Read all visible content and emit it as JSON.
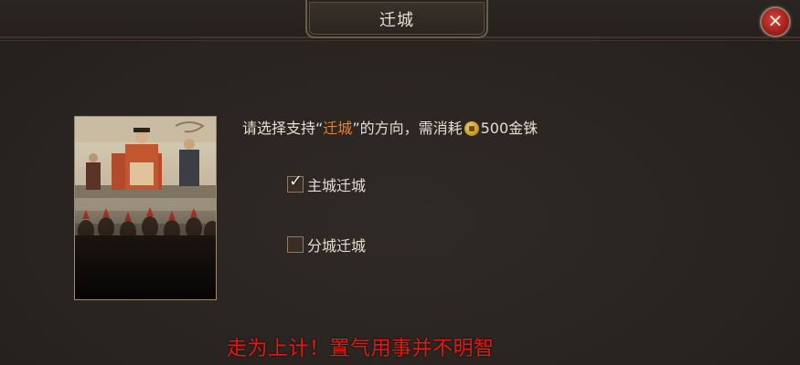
{
  "dialog": {
    "title": "迁城",
    "close_icon": "close-x-icon"
  },
  "prompt": {
    "text_before": "请选择支持“",
    "highlight": "迁城",
    "text_middle": "”的方向，需消耗",
    "cost_icon": "gold-coin-icon",
    "cost_amount": "500",
    "cost_unit": "金铢"
  },
  "options": [
    {
      "label": "主城迁城",
      "checked": true
    },
    {
      "label": "分城迁城",
      "checked": false
    }
  ],
  "caption": "走为上计！置气用事并不明智",
  "colors": {
    "highlight": "#e0823b",
    "caption": "#e21b12",
    "close_button": "#a5231f"
  }
}
